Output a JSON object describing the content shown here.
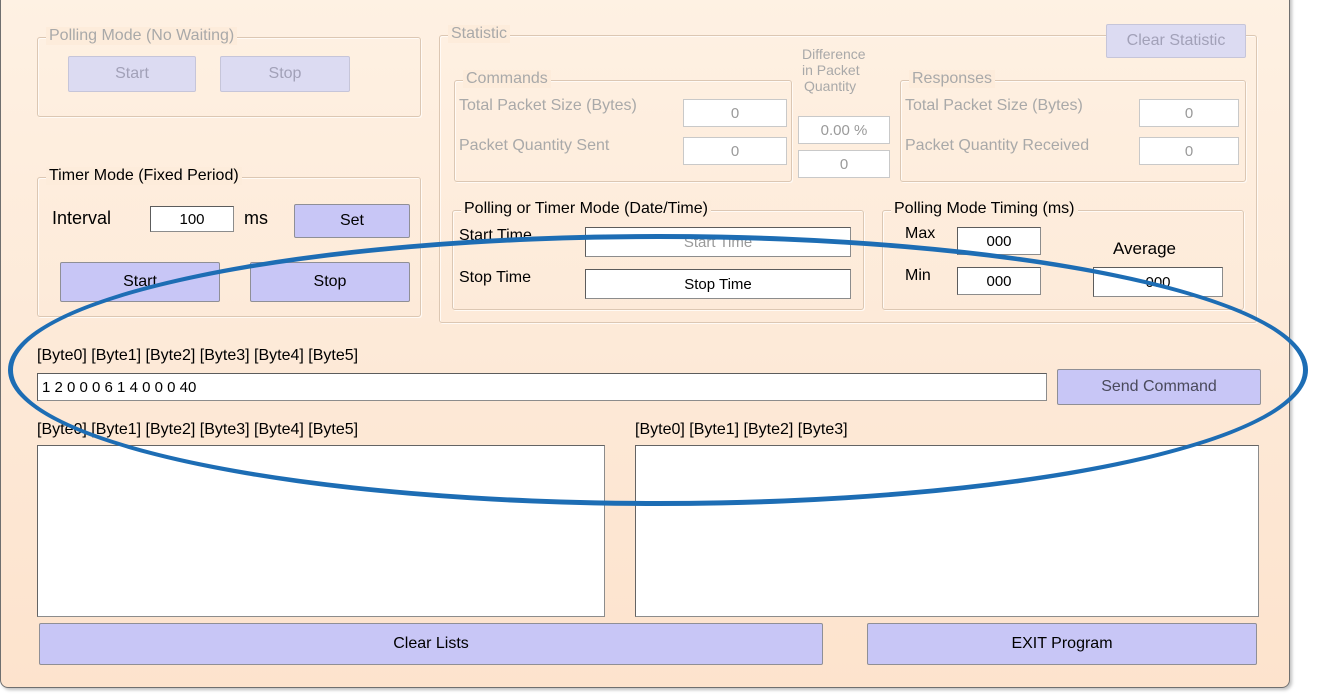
{
  "polling_mode": {
    "legend": "Polling Mode (No Waiting)",
    "start_label": "Start",
    "stop_label": "Stop"
  },
  "timer_mode": {
    "legend": "Timer Mode (Fixed Period)",
    "interval_label": "Interval",
    "interval_value": "100",
    "unit": "ms",
    "set_label": "Set",
    "start_label": "Start",
    "stop_label": "Stop"
  },
  "statistic": {
    "legend": "Statistic",
    "clear_label": "Clear Statistic",
    "commands": {
      "legend": "Commands",
      "total_size_label": "Total Packet Size (Bytes)",
      "total_size_value": "0",
      "quantity_label": "Packet Quantity Sent",
      "quantity_value": "0"
    },
    "difference": {
      "line1": "Difference",
      "line2": "in Packet",
      "line3": "Quantity",
      "percent_value": "0.00 %",
      "count_value": "0"
    },
    "responses": {
      "legend": "Responses",
      "total_size_label": "Total Packet Size (Bytes)",
      "total_size_value": "0",
      "quantity_label": "Packet Quantity Received",
      "quantity_value": "0"
    }
  },
  "date_time": {
    "legend": "Polling  or Timer Mode  (Date/Time)",
    "start_label": "Start Time",
    "start_value": "Start Time",
    "stop_label": "Stop Time",
    "stop_value": "Stop Time"
  },
  "timing": {
    "legend": "Polling Mode Timing (ms)",
    "max_label": "Max",
    "max_value": "000",
    "min_label": "Min",
    "min_value": "000",
    "average_label": "Average",
    "average_value": "000"
  },
  "command": {
    "header": "[Byte0]  [Byte1]  [Byte2]  [Byte3]  [Byte4]  [Byte5]",
    "value": "1 2 0 0 0 6    1  4  0  0  0  40",
    "send_label": "Send Command"
  },
  "lists": {
    "left_header": "[Byte0]  [Byte1]  [Byte2]  [Byte3]  [Byte4]  [Byte5]",
    "right_header": "[Byte0]  [Byte1]  [Byte2]  [Byte3]"
  },
  "footer": {
    "clear_label": "Clear Lists",
    "exit_label": "EXIT Program"
  },
  "colors": {
    "window_bg": "#fde9d7",
    "button": "#c8c6f6",
    "annotation": "#1d6db4"
  }
}
